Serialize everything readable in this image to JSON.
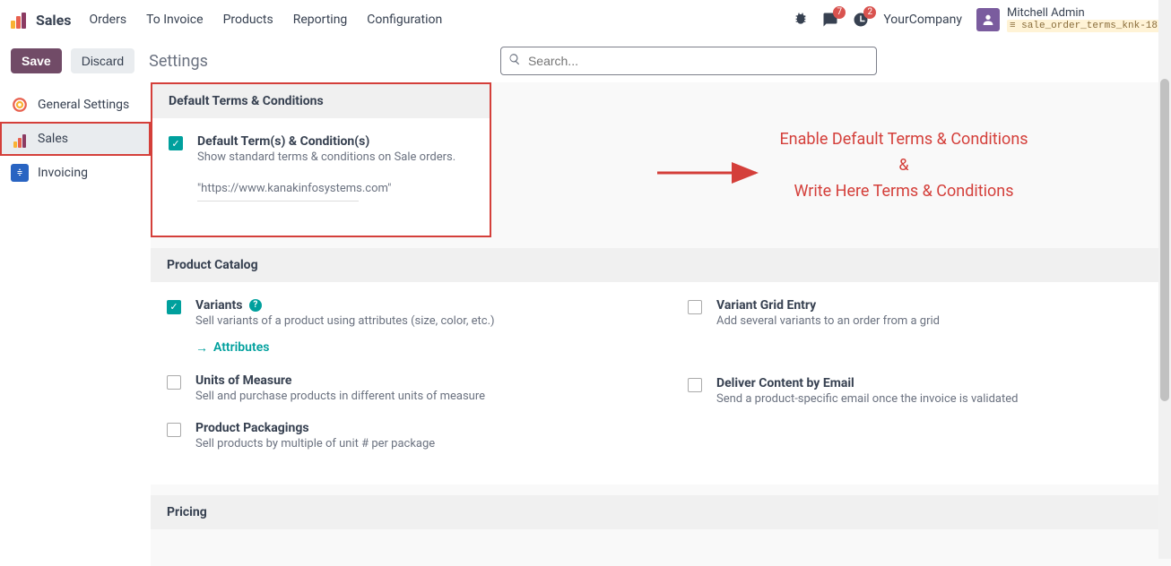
{
  "topbar": {
    "brand": "Sales",
    "menu": [
      "Orders",
      "To Invoice",
      "Products",
      "Reporting",
      "Configuration"
    ],
    "chat_badge": "7",
    "clock_badge": "2",
    "company": "YourCompany",
    "user_name": "Mitchell Admin",
    "db_name": "sale_order_terms_knk-18"
  },
  "actionbar": {
    "save": "Save",
    "discard": "Discard",
    "title": "Settings",
    "search_placeholder": "Search..."
  },
  "sidebar": {
    "items": [
      {
        "label": "General Settings"
      },
      {
        "label": "Sales"
      },
      {
        "label": "Invoicing"
      }
    ]
  },
  "sections": {
    "terms": {
      "heading": "Default Terms & Conditions",
      "opt_title": "Default Term(s) & Condition(s)",
      "opt_desc": "Show standard terms & conditions on Sale orders.",
      "value": "\"https://www.kanakinfosystems.com\""
    },
    "catalog": {
      "heading": "Product Catalog",
      "variants_title": "Variants",
      "variants_desc": "Sell variants of a product using attributes (size, color, etc.)",
      "variants_link": "Attributes",
      "grid_title": "Variant Grid Entry",
      "grid_desc": "Add several variants to an order from a grid",
      "uom_title": "Units of Measure",
      "uom_desc": "Sell and purchase products in different units of measure",
      "email_title": "Deliver Content by Email",
      "email_desc": "Send a product-specific email once the invoice is validated",
      "pack_title": "Product Packagings",
      "pack_desc": "Sell products by multiple of unit # per package"
    },
    "pricing": {
      "heading": "Pricing"
    }
  },
  "annotation": {
    "line1": "Enable Default Terms & Conditions",
    "line2": "&",
    "line3": "Write Here Terms & Conditions"
  }
}
